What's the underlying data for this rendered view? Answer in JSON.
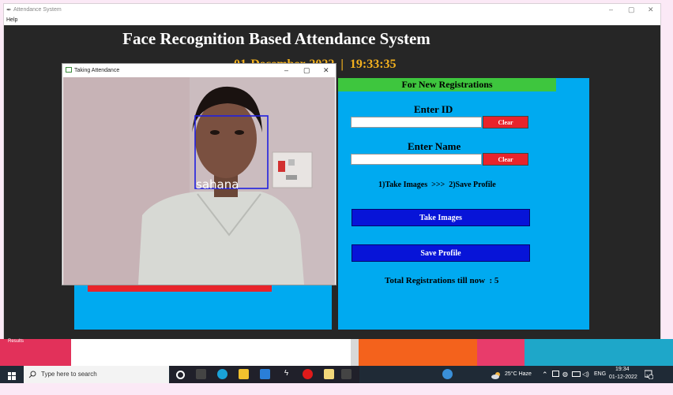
{
  "window": {
    "title": "Attendance System",
    "menu": [
      "Help"
    ],
    "controls": [
      "–",
      "▢",
      "✕"
    ]
  },
  "header": {
    "title": "Face Recognition Based Attendance System",
    "datetime_visible": "01-December-2022  |  19:33:35"
  },
  "registration": {
    "header": "For New Registrations",
    "id_label": "Enter ID",
    "id_value": "",
    "id_clear": "Clear",
    "name_label": "Enter Name",
    "name_value": "",
    "name_clear": "Clear",
    "steps": "1)Take Images  >>>  2)Save Profile",
    "take_images": "Take Images",
    "save_profile": "Save Profile",
    "total": "Total Registrations till now  : 5"
  },
  "popup": {
    "title": "Taking Attendance",
    "controls": [
      "–",
      "▢",
      "✕"
    ],
    "detected_name": "sahana"
  },
  "taskbar": {
    "search_placeholder": "Type here to search",
    "weather": "25°C  Haze",
    "lang": "ENG",
    "time": "19:34",
    "date": "01-12-2022",
    "notification_count": "1",
    "desktop_label": "Results"
  },
  "colors": {
    "accent_green": "#3ec63e",
    "panel_blue": "#00aaf0",
    "button_blue": "#0714d8",
    "clear_red": "#e8242b",
    "datetime_orange": "#f2b01e"
  }
}
